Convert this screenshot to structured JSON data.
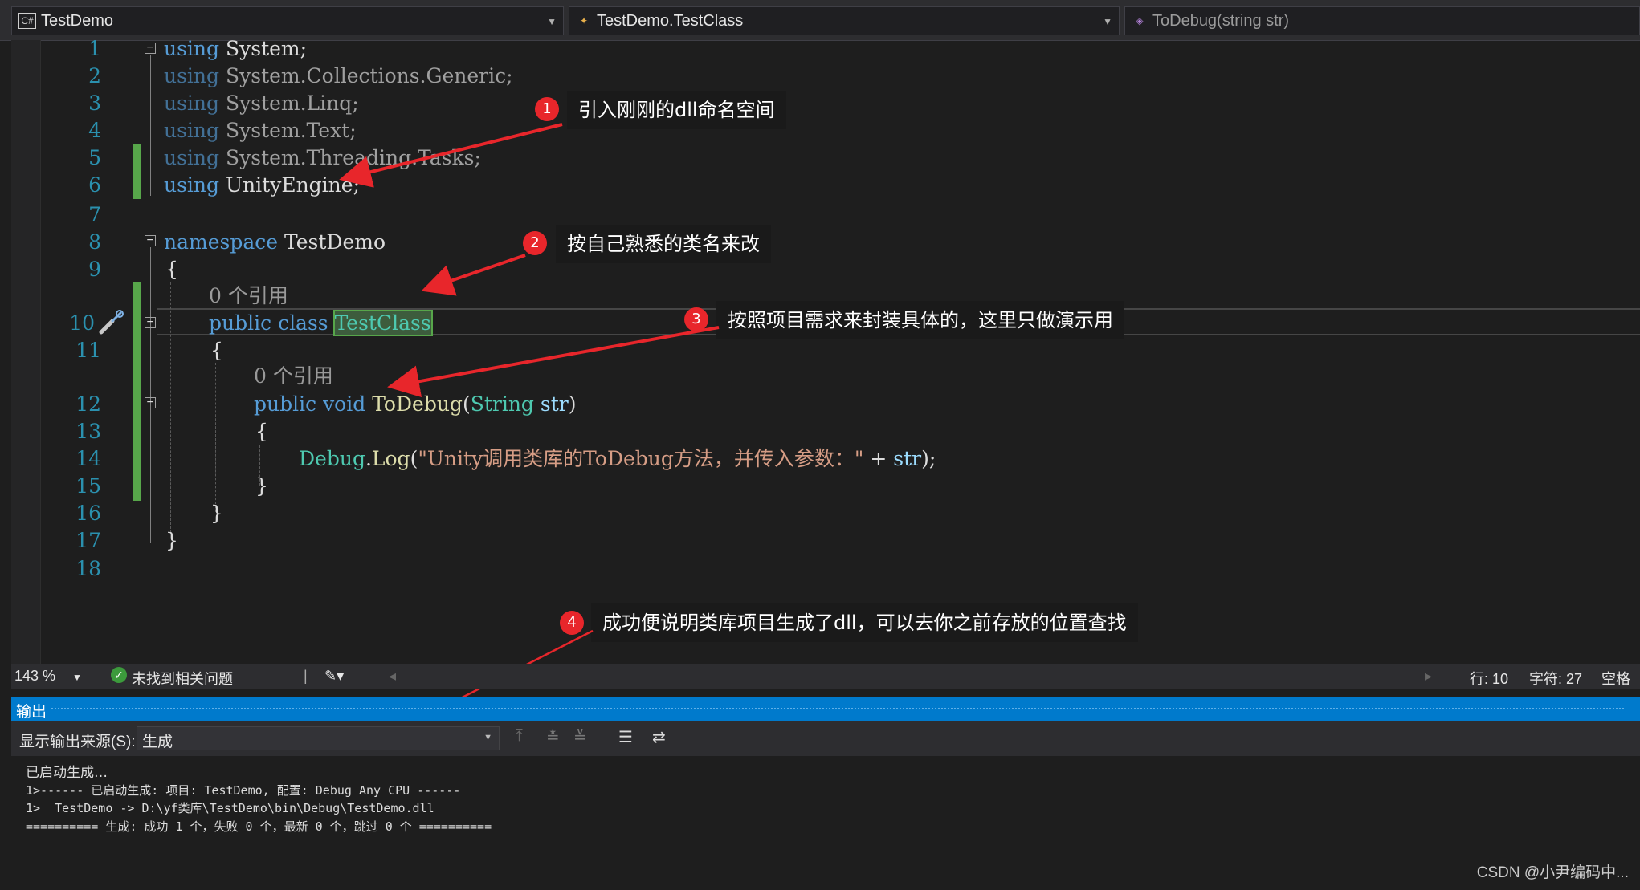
{
  "nav": {
    "project": "TestDemo",
    "class_path": "TestDemo.TestClass",
    "member": "ToDebug(string str)"
  },
  "lines": {
    "n1": "1",
    "n2": "2",
    "n3": "3",
    "n4": "4",
    "n5": "5",
    "n6": "6",
    "n7": "7",
    "n8": "8",
    "n9": "9",
    "n10": "10",
    "n11": "11",
    "n12": "12",
    "n13": "13",
    "n14": "14",
    "n15": "15",
    "n16": "16",
    "n17": "17",
    "n18": "18"
  },
  "code": {
    "using_kw": "using",
    "u1": "System;",
    "u2": "System.Collections.Generic;",
    "u3": "System.Linq;",
    "u4": "System.Text;",
    "u5": "System.Threading.Tasks;",
    "u6": "UnityEngine;",
    "namespace_kw": "namespace",
    "namespace_name": "TestDemo",
    "open_brace": "{",
    "close_brace": "}",
    "ref_count": "0 个引用",
    "public_kw": "public",
    "class_kw": "class",
    "class_name": "TestClass",
    "void_kw": "void",
    "method_name": "ToDebug",
    "open_paren": "(",
    "param_type": "String",
    "param_name": "str",
    "close_paren": ")",
    "debug_type": "Debug",
    "dot": ".",
    "log_fn": "Log",
    "log_string": "\"Unity调用类库的ToDebug方法，并传入参数：\"",
    "plus": "+",
    "str_var": "str",
    "end_stmt": ");"
  },
  "annotations": [
    {
      "num": "1",
      "text": "引入刚刚的dll命名空间"
    },
    {
      "num": "2",
      "text": "按自己熟悉的类名来改"
    },
    {
      "num": "3",
      "text": "按照项目需求来封装具体的，这里只做演示用"
    },
    {
      "num": "4",
      "text": "成功便说明类库项目生成了dll，可以去你之前存放的位置查找"
    }
  ],
  "status": {
    "zoom": "143 %",
    "issues": "未找到相关问题",
    "line": "行: 10",
    "char": "字符: 27",
    "space": "空格"
  },
  "output": {
    "title": "输出",
    "source_label": "显示输出来源(S):",
    "source_value": "生成",
    "lines": [
      "已启动生成…",
      "1>------ 已启动生成: 项目: TestDemo, 配置: Debug Any CPU ------",
      "1>  TestDemo -> D:\\yf类库\\TestDemo\\bin\\Debug\\TestDemo.dll",
      "========== 生成: 成功 1 个，失败 0 个，最新 0 个，跳过 0 个 =========="
    ]
  },
  "watermark": "CSDN @小尹编码中...",
  "colors": {
    "keyword": "#569cd6",
    "type": "#4ec9b0",
    "method": "#dcdcaa",
    "string": "#d69d85",
    "line_number": "#2b91af",
    "accent": "#007acc",
    "annotation": "#e8262b"
  }
}
